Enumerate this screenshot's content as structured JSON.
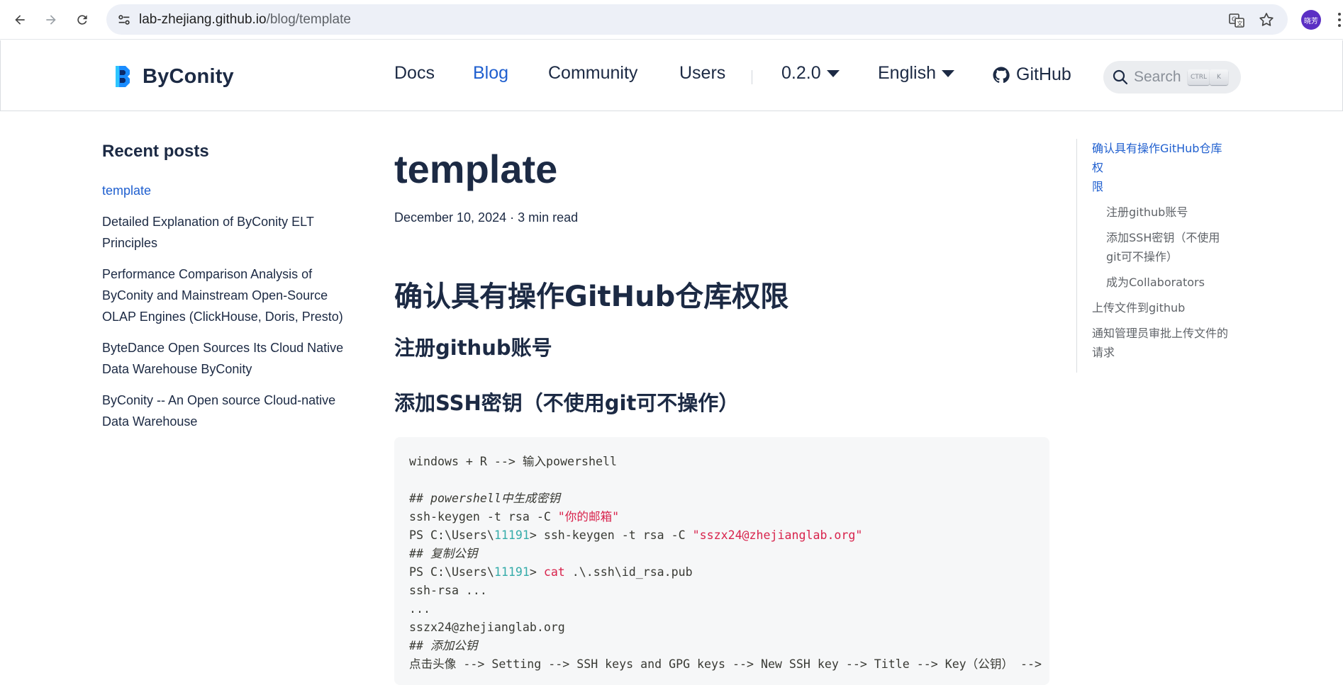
{
  "browser": {
    "url_host": "lab-zhejiang.github.io",
    "url_path": "/blog/template",
    "profile_initials": "晓芳",
    "icons": [
      "back-icon",
      "forward-icon",
      "reload-icon",
      "site-info-icon",
      "translate-icon",
      "star-icon",
      "more-icon"
    ]
  },
  "site": {
    "brand": "ByConity",
    "nav": {
      "docs": "Docs",
      "blog": "Blog",
      "community": "Community",
      "users": "Users",
      "version": "0.2.0",
      "language": "English",
      "github": "GitHub"
    },
    "search": {
      "placeholder": "Search",
      "key1": "CTRL",
      "key2": "K"
    },
    "colors": {
      "accent": "#1f5fcf",
      "text": "#1c2a44"
    }
  },
  "sidebar": {
    "title": "Recent posts",
    "posts": [
      "template",
      "Detailed Explanation of ByConity ELT",
      "Principles",
      "Performance Comparison Analysis of",
      "ByConity and Mainstream Open-Source",
      "OLAP Engines (ClickHouse, Doris, Presto)",
      "ByteDance Open Sources Its Cloud Native",
      "Data Warehouse ByConity",
      "ByConity -- An Open source Cloud-native",
      "Data Warehouse"
    ]
  },
  "article": {
    "title": "template",
    "meta": "December 10, 2024 · 3 min read",
    "h2": "确认具有操作GitHub仓库权限",
    "h3_register": "注册github账号",
    "h3_ssh": "添加SSH密钥（不使用git可不操作）",
    "code": {
      "l1": "windows + R --> 输入powershell",
      "l3": "## powershell中生成密钥",
      "l4a": "ssh-keygen -t rsa -C ",
      "l4b": "\"你的邮箱\"",
      "l5a": "PS C:\\Users\\",
      "l5b": "11191",
      "l5c": "> ssh-keygen -t rsa -C ",
      "l5d": "\"sszx24@zhejianglab.org\"",
      "l6": "## 复制公钥",
      "l7a": "PS C:\\Users\\",
      "l7b": "11191",
      "l7c": "> ",
      "l7d": "cat",
      "l7e": " .\\.ssh\\id_rsa.pub",
      "l8": "ssh-rsa ...",
      "l9": "...",
      "l10": "sszx24@zhejianglab.org",
      "l11": "## 添加公钥",
      "l12": "点击头像 --> Setting --> SSH keys and GPG keys --> New SSH key --> Title --> Key（公钥） -->"
    }
  },
  "toc": {
    "items": [
      "确认具有操作GitHub仓库权",
      "限",
      "注册github账号",
      "添加SSH密钥（不使用",
      "git可不操作）",
      "成为Collaborators",
      "上传文件到github",
      "通知管理员审批上传文件的",
      "请求"
    ]
  }
}
